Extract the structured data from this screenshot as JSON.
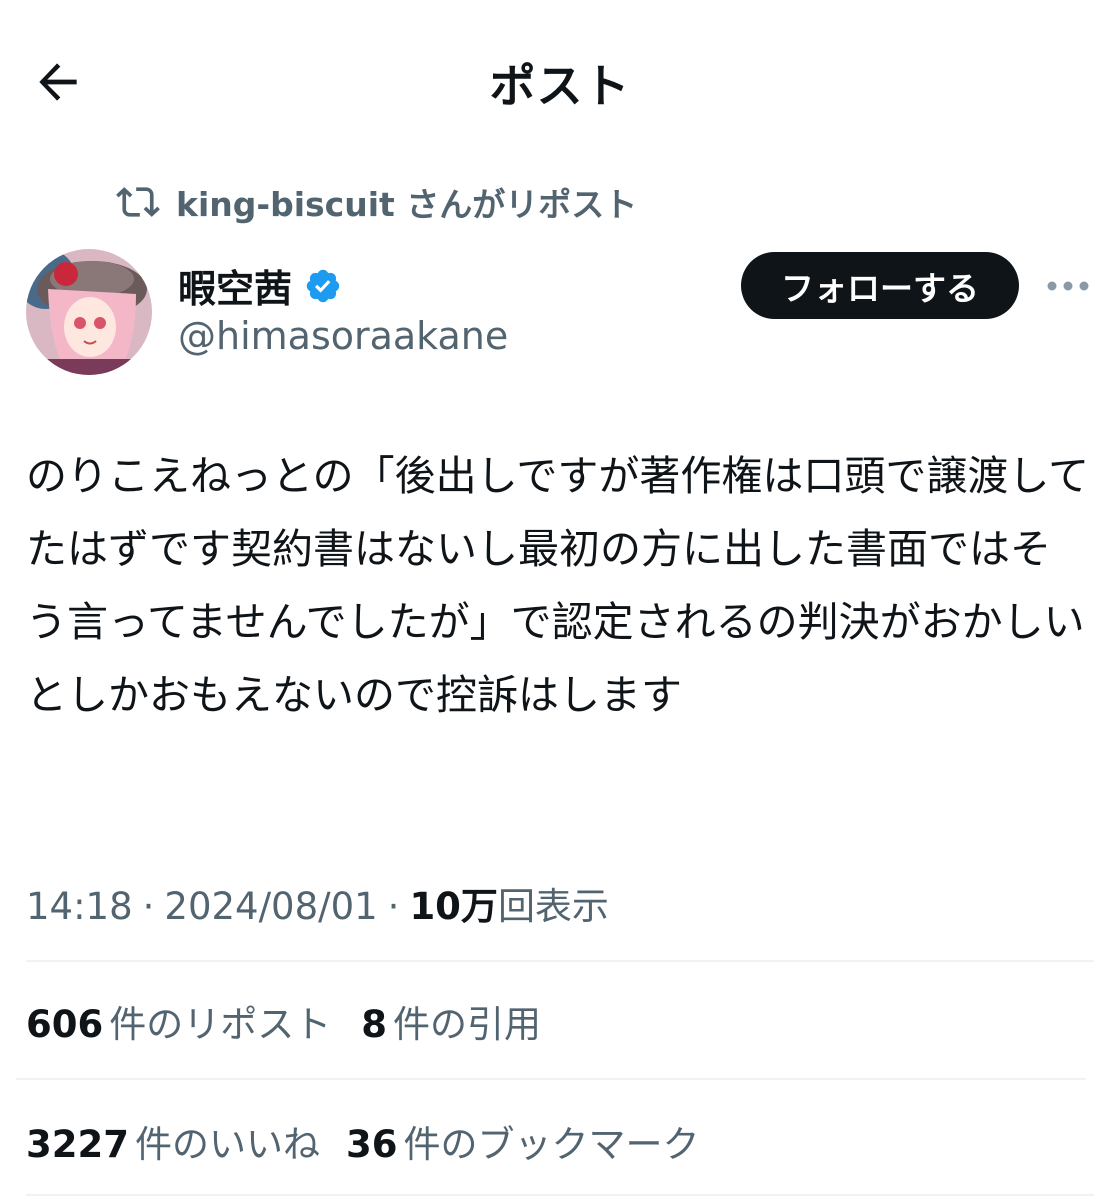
{
  "header": {
    "title": "ポスト",
    "back_icon": "arrow-left-icon"
  },
  "repost_context": {
    "text": "king-biscuit さんがリポスト",
    "icon": "repost-icon"
  },
  "author": {
    "display_name": "暇空茜",
    "handle": "@himasoraakane",
    "verified": true,
    "verified_color": "#1d9bf0"
  },
  "follow_button": {
    "label": "フォローする"
  },
  "tweet": {
    "text": "のりこえねっとの「後出しですが著作権は口頭で譲渡してたはずです契約書はないし最初の方に出した書面ではそう言ってませんでしたが」で認定されるの判決がおかしいとしかおもえないので控訴はします"
  },
  "meta": {
    "time": "14:18",
    "separator": "·",
    "date": "2024/08/01",
    "views_number": "10万",
    "views_label": "回表示"
  },
  "stats_row1": {
    "reposts_number": "606",
    "reposts_label": "件のリポスト",
    "quotes_number": "8",
    "quotes_label": "件の引用"
  },
  "stats_row2": {
    "likes_number": "3227",
    "likes_label": "件のいいね",
    "bookmarks_number": "36",
    "bookmarks_label": "件のブックマーク"
  },
  "colors": {
    "text": "#0f1419",
    "secondary": "#536471",
    "divider": "#eff3f4",
    "button_bg": "#0f1419"
  }
}
